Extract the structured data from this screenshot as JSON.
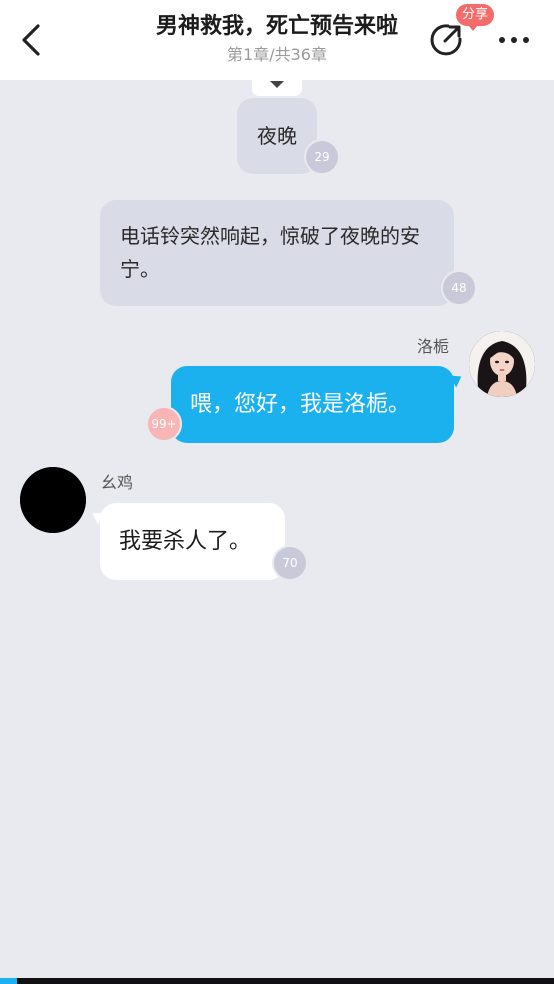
{
  "header": {
    "title": "男神救我，死亡预告来啦",
    "subtitle": "第1章/共36章",
    "share_badge": "分享"
  },
  "messages": [
    {
      "type": "narration",
      "text": "夜晚",
      "count": "29"
    },
    {
      "type": "narration",
      "text": "电话铃突然响起，惊破了夜晚的安宁。",
      "count": "48"
    },
    {
      "type": "right",
      "speaker": "洛栀",
      "text": "喂，您好，我是洛栀。",
      "count": "99+"
    },
    {
      "type": "left",
      "speaker": "幺鸡",
      "text": "我要杀人了。",
      "count": "70"
    }
  ],
  "icons": {
    "back": "back-arrow-icon",
    "share": "share-icon",
    "more": "more-icon"
  },
  "colors": {
    "accent": "#1ab1ee",
    "badge_red": "#f46b6b",
    "narration_bg": "#d9dbe6",
    "background": "#e9eaef"
  },
  "reading_progress": 0.03
}
